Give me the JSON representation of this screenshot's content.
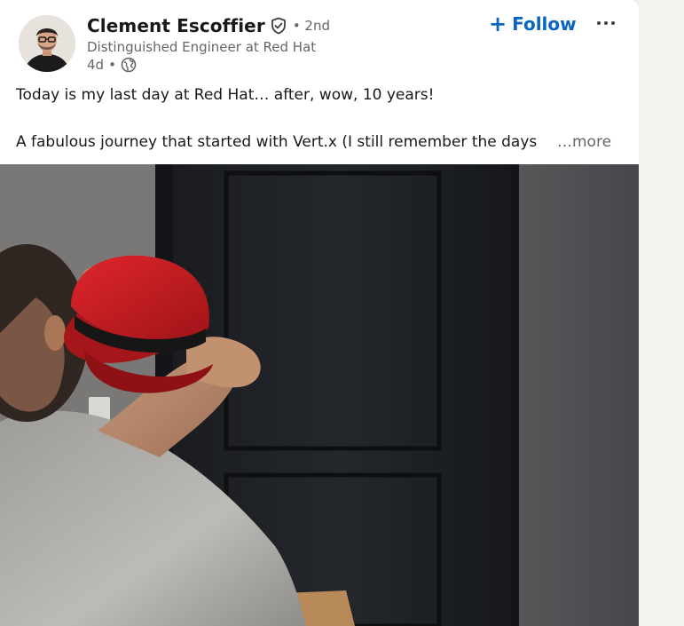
{
  "post": {
    "author": {
      "name": "Clement Escoffier",
      "connection_degree": "• 2nd",
      "headline": "Distinguished Engineer at Red Hat",
      "posted_time": "4d",
      "visibility_separator": "•",
      "verified": true,
      "visibility_icon": "globe-icon"
    },
    "actions": {
      "follow_plus": "+",
      "follow_label": "Follow",
      "more_label": "···"
    },
    "text": {
      "line1": "Today is my last day at Red Hat… after, wow, 10 years!",
      "line2": "A fabulous journey that started with Vert.x (I still remember the days",
      "see_more": "…more"
    },
    "image": {
      "description_icon": "photo-man-holding-red-fedora",
      "hat_color": "#cc1f24",
      "door_color": "#1f2125"
    }
  },
  "colors": {
    "accent": "#0a66c2",
    "text_primary": "#191919",
    "text_secondary": "#666666",
    "card_bg": "#ffffff",
    "page_bg": "#f4f2ee"
  }
}
